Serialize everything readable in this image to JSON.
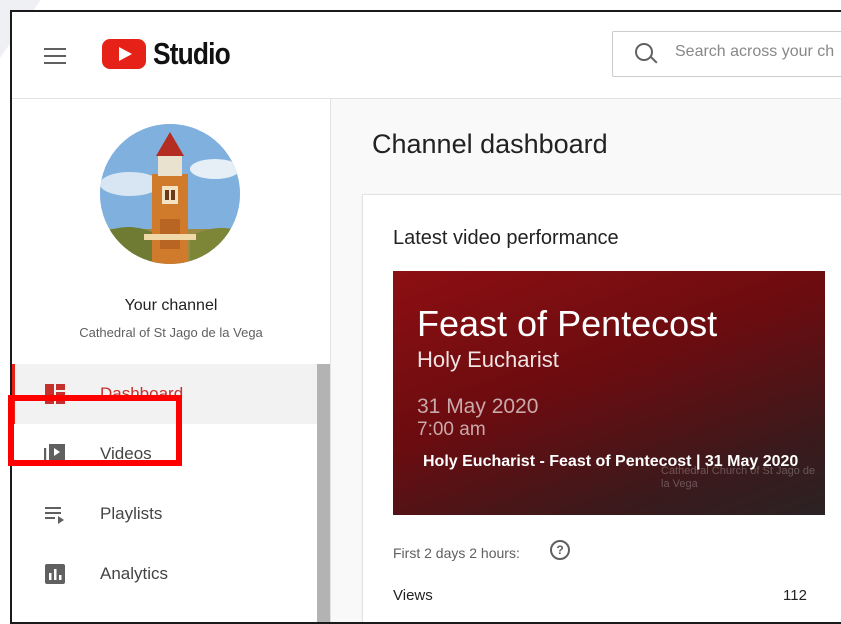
{
  "header": {
    "logo_text": "Studio",
    "search_placeholder": "Search across your ch"
  },
  "sidebar": {
    "channel_label": "Your channel",
    "channel_name": "Cathedral of St Jago de la Vega",
    "items": [
      {
        "label": "Dashboard",
        "icon": "dashboard-icon",
        "active": true
      },
      {
        "label": "Videos",
        "icon": "videos-icon",
        "active": false
      },
      {
        "label": "Playlists",
        "icon": "playlists-icon",
        "active": false
      },
      {
        "label": "Analytics",
        "icon": "analytics-icon",
        "active": false
      }
    ]
  },
  "main": {
    "title": "Channel dashboard",
    "card": {
      "title": "Latest video performance",
      "thumbnail": {
        "heading": "Feast of Pentecost",
        "subheading": "Holy Eucharist",
        "date": "31 May 2020",
        "time": "7:00 am",
        "video_title": "Holy Eucharist - Feast of Pentecost | 31 May 2020",
        "watermark": "Cathedral Church of St Jago de la Vega"
      },
      "period_label": "First 2 days 2 hours:",
      "metrics": [
        {
          "label": "Views",
          "value": "112"
        }
      ]
    }
  },
  "colors": {
    "accent": "#e62117",
    "highlight": "#ff0000"
  }
}
